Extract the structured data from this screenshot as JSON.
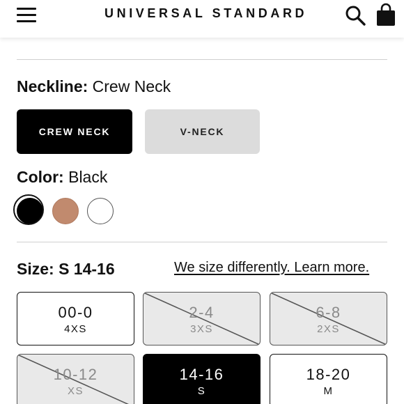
{
  "header": {
    "brand": "UNIVERSAL STANDARD",
    "menu_icon": "hamburger-menu-icon",
    "search_icon": "search-icon",
    "bag_icon": "shopping-bag-icon"
  },
  "neckline": {
    "label": "Neckline:",
    "selected_value": "Crew Neck",
    "options": [
      {
        "label": "CREW NECK",
        "selected": true
      },
      {
        "label": "V-NECK",
        "selected": false
      }
    ]
  },
  "color": {
    "label": "Color:",
    "selected_value": "Black",
    "swatches": [
      {
        "name": "black",
        "hex": "#000000",
        "selected": true
      },
      {
        "name": "tan",
        "hex": "#c18a6e",
        "selected": false
      },
      {
        "name": "white",
        "hex": "#ffffff",
        "selected": false
      }
    ]
  },
  "size": {
    "label": "Size:",
    "selected_value": "S 14-16",
    "guide_link": "We size differently. Learn more.",
    "options": [
      {
        "range": "00-0",
        "label": "4XS",
        "available": true,
        "selected": false
      },
      {
        "range": "2-4",
        "label": "3XS",
        "available": false,
        "selected": false
      },
      {
        "range": "6-8",
        "label": "2XS",
        "available": false,
        "selected": false
      },
      {
        "range": "10-12",
        "label": "XS",
        "available": false,
        "selected": false
      },
      {
        "range": "14-16",
        "label": "S",
        "available": true,
        "selected": true
      },
      {
        "range": "18-20",
        "label": "M",
        "available": true,
        "selected": false
      }
    ]
  }
}
